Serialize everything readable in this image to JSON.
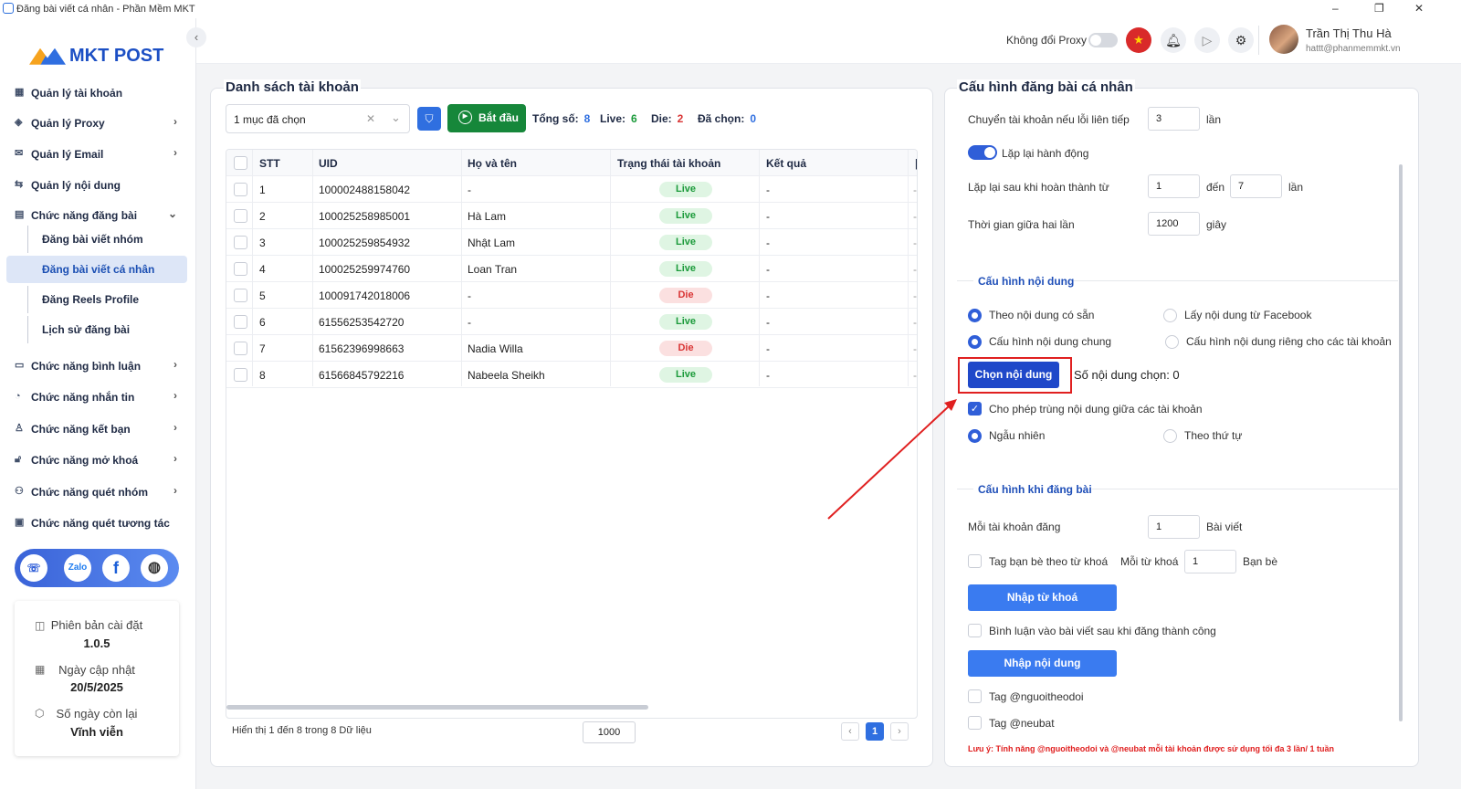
{
  "window": {
    "title": "Đăng bài viết cá nhân - Phần Mềm MKT",
    "min": "–",
    "max": "❐",
    "close": "✕"
  },
  "brand": {
    "name": "MKT POST"
  },
  "nav": {
    "items": [
      {
        "label": "Quản lý tài khoản",
        "icon": "grid-icon"
      },
      {
        "label": "Quản lý Proxy",
        "icon": "layers-icon"
      },
      {
        "label": "Quản lý Email",
        "icon": "mail-icon"
      },
      {
        "label": "Quản lý nội dung",
        "icon": "content-icon"
      },
      {
        "label": "Chức năng đăng bài",
        "icon": "post-icon"
      }
    ],
    "sub": [
      {
        "label": "Đăng bài viết nhóm"
      },
      {
        "label": "Đăng bài viết cá nhân"
      },
      {
        "label": "Đăng Reels Profile"
      },
      {
        "label": "Lịch sử đăng bài"
      }
    ],
    "items2": [
      {
        "label": "Chức năng bình luận"
      },
      {
        "label": "Chức năng nhắn tin"
      },
      {
        "label": "Chức năng kết bạn"
      },
      {
        "label": "Chức năng mở khoá"
      },
      {
        "label": "Chức năng quét nhóm"
      },
      {
        "label": "Chức năng quét tương tác"
      }
    ]
  },
  "social": {
    "zalo": "Zalo"
  },
  "info": {
    "version_label": "Phiên bản cài đặt",
    "version": "1.0.5",
    "update_label": "Ngày cập nhật",
    "update": "20/5/2025",
    "days_label": "Số ngày còn lại",
    "days": "Vĩnh viễn"
  },
  "header": {
    "proxy_label": "Không đổi Proxy",
    "user_name": "Trần Thị Thu Hà",
    "user_email": "hattt@phanmemmkt.vn"
  },
  "accounts": {
    "title": "Danh sách tài khoản",
    "select_value": "1 mục đã chọn",
    "start_label": "Bắt đầu",
    "total_label": "Tổng số:",
    "total": "8",
    "live_label": "Live:",
    "live": "6",
    "die_label": "Die:",
    "die": "2",
    "selected_label": "Đã chọn:",
    "selected": "0",
    "columns": [
      "STT",
      "UID",
      "Họ và tên",
      "Trạng thái tài khoản",
      "Kết quả"
    ],
    "rows": [
      {
        "stt": "1",
        "uid": "100002488158042",
        "name": "-",
        "status": "Live",
        "result": "-"
      },
      {
        "stt": "2",
        "uid": "100025258985001",
        "name": "Hà Lam",
        "status": "Live",
        "result": "-"
      },
      {
        "stt": "3",
        "uid": "100025259854932",
        "name": "Nhật Lam",
        "status": "Live",
        "result": "-"
      },
      {
        "stt": "4",
        "uid": "100025259974760",
        "name": "Loan Tran",
        "status": "Live",
        "result": "-"
      },
      {
        "stt": "5",
        "uid": "100091742018006",
        "name": "-",
        "status": "Die",
        "result": "-"
      },
      {
        "stt": "6",
        "uid": "61556253542720",
        "name": "-",
        "status": "Live",
        "result": "-"
      },
      {
        "stt": "7",
        "uid": "61562396998663",
        "name": "Nadia Willa",
        "status": "Die",
        "result": "-"
      },
      {
        "stt": "8",
        "uid": "61566845792216",
        "name": "Nabeela Sheikh",
        "status": "Live",
        "result": "-"
      }
    ],
    "footer_text": "Hiển thị 1 đến 8 trong 8 Dữ liệu",
    "page_size": "1000",
    "page": "1",
    "prev": "‹",
    "next": "›"
  },
  "config": {
    "title": "Cấu hình đăng bài cá nhân",
    "switch_label": "Chuyển tài khoản nếu lỗi liên tiếp",
    "switch_value": "3",
    "switch_unit": "lần",
    "repeat_label": "Lặp lại hành động",
    "repeat_after_label": "Lặp lại sau khi hoàn thành từ",
    "repeat_from": "1",
    "repeat_to_label": "đến",
    "repeat_to": "7",
    "repeat_unit": "lần",
    "interval_label": "Thời gian giữa hai lần",
    "interval": "1200",
    "interval_unit": "giây",
    "content_section": "Cấu hình nội dung",
    "opt_existing": "Theo nội dung có sẵn",
    "opt_facebook": "Lấy nội dung từ Facebook",
    "opt_common": "Cấu hình nội dung chung",
    "opt_separate": "Cấu hình nội dung riêng cho các tài khoản",
    "choose_btn": "Chọn nội dung",
    "chosen_count": "Số nội dung chọn: 0",
    "allow_dup": "Cho phép trùng nội dung giữa các tài khoản",
    "opt_random": "Ngẫu nhiên",
    "opt_order": "Theo thứ tự",
    "post_section": "Cấu hình khi đăng bài",
    "per_account_label": "Mỗi tài khoản đăng",
    "per_account": "1",
    "per_account_unit": "Bài viết",
    "tag_friends": "Tag bạn bè theo từ khoá",
    "per_keyword_label": "Mỗi từ khoá",
    "per_keyword": "1",
    "per_keyword_unit": "Bạn bè",
    "import_keywords": "Nhập từ khoá",
    "comment_after": "Bình luận vào bài viết sau khi đăng thành công",
    "import_content": "Nhập nội dung",
    "tag_follow": "Tag @nguoitheodoi",
    "tag_neubat": "Tag @neubat",
    "note": "Lưu ý: Tính năng @nguoitheodoi và @neubat mỗi tài khoản được sử dụng tối đa 3 lần/ 1 tuần"
  },
  "colors": {
    "accent": "#2f5ed8",
    "start": "#16873a",
    "live": "#1b9a3a",
    "die": "#d93535",
    "annot": "#e02020"
  }
}
